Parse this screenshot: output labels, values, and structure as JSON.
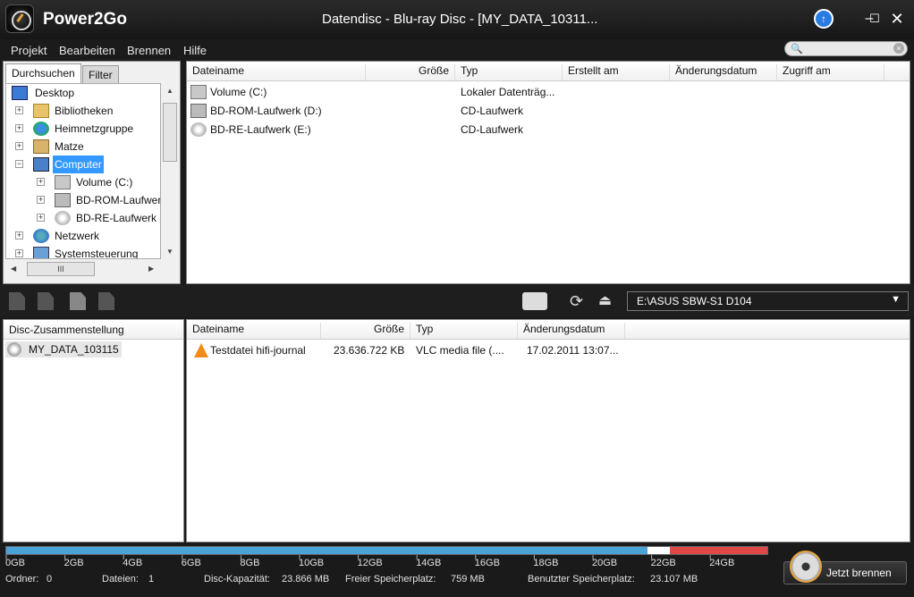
{
  "app": {
    "name": "Power2Go",
    "window_title": "Datendisc - Blu-ray Disc - [MY_DATA_10311..."
  },
  "menu": [
    "Projekt",
    "Bearbeiten",
    "Brennen",
    "Hilfe"
  ],
  "browse": {
    "tabs": [
      "Durchsuchen",
      "Filter"
    ],
    "tree": [
      "Desktop",
      "Bibliotheken",
      "Heimnetzgruppe",
      "Matze",
      "Computer",
      "Volume (C:)",
      "BD-ROM-Laufwerk",
      "BD-RE-Laufwerk (",
      "Netzwerk",
      "Systemsteuerung"
    ],
    "scroll_mark": "III"
  },
  "file_list": {
    "columns": [
      "Dateiname",
      "Größe",
      "Typ",
      "Erstellt am",
      "Änderungsdatum",
      "Zugriff am"
    ],
    "rows": [
      {
        "name": "Volume (C:)",
        "size": "",
        "type": "Lokaler Datenträg..."
      },
      {
        "name": "BD-ROM-Laufwerk (D:)",
        "size": "",
        "type": "CD-Laufwerk"
      },
      {
        "name": "BD-RE-Laufwerk (E:)",
        "size": "",
        "type": "CD-Laufwerk"
      }
    ]
  },
  "toolbar": {
    "drive": "E:\\ASUS SBW-S1 D104"
  },
  "composition": {
    "header": "Disc-Zusammenstellung",
    "disc_name": "MY_DATA_103115"
  },
  "disc_list": {
    "columns": [
      "Dateiname",
      "Größe",
      "Typ",
      "Änderungsdatum"
    ],
    "rows": [
      {
        "name": "Testdatei hifi-journal",
        "size": "23.636.722 KB",
        "type": "VLC media file (....",
        "date": "17.02.2011 13:07..."
      }
    ]
  },
  "capacity": {
    "labels": [
      "0GB",
      "2GB",
      "4GB",
      "6GB",
      "8GB",
      "10GB",
      "12GB",
      "14GB",
      "16GB",
      "18GB",
      "20GB",
      "22GB",
      "24GB"
    ],
    "used_fraction": 0.872,
    "overflow_fraction": 0.128
  },
  "status": {
    "folders_label": "Ordner:",
    "folders": "0",
    "files_label": "Dateien:",
    "files": "1",
    "capacity_label": "Disc-Kapazität:",
    "capacity": "23.866 MB",
    "free_label": "Freier Speicherplatz:",
    "free": "759 MB",
    "used_label": "Benutzter Speicherplatz:",
    "used": "23.107 MB"
  },
  "burn_button": "Jetzt brennen",
  "colors": {
    "accent_blue": "#4aa3d8",
    "warning_red": "#e04848",
    "selection": "#3399ff"
  }
}
